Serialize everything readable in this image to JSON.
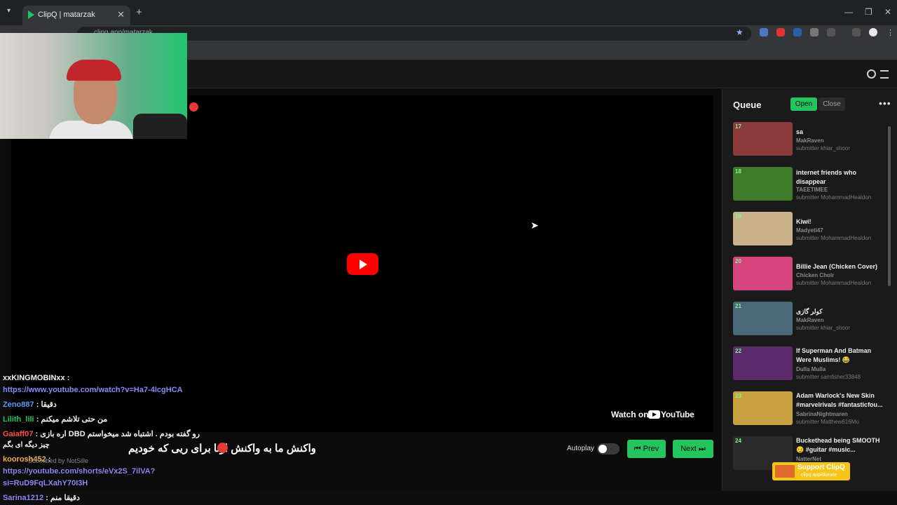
{
  "browser": {
    "tab_title": "ClipQ | matarzak",
    "tab_close": "✕",
    "new_tab": "+",
    "url": "clipq.app/matarzak",
    "window_controls": [
      "—",
      "❐",
      "✕"
    ]
  },
  "player": {
    "watch_on": "Watch on",
    "youtube": "YouTube",
    "autoplay_label": "Autoplay",
    "prev_label": "⏮ Prev",
    "next_label": "Next ⏭"
  },
  "queue": {
    "title": "Queue",
    "open_label": "Open",
    "close_label": "Close",
    "more": "•••",
    "items": [
      {
        "num": "17",
        "title": "sa",
        "channel": "MakRaven",
        "submitter": "submitter khiar_shoor",
        "thumb": "#8a3a3a"
      },
      {
        "num": "18",
        "title": "internet friends who disappear",
        "channel": "TAEETIMEE",
        "submitter": "submitter MohammadHealdon",
        "thumb": "#3f7a2a"
      },
      {
        "num": "19",
        "title": "Kiwi!",
        "channel": "Madyeti47",
        "submitter": "submitter MohammadHealdon",
        "thumb": "#c9b28a"
      },
      {
        "num": "20",
        "title": "Billie Jean (Chicken Cover)",
        "channel": "Chicken Choir",
        "submitter": "submitter MohammadHealdon",
        "thumb": "#d6457e"
      },
      {
        "num": "21",
        "title": "کولر گازی",
        "channel": "MakRaven",
        "submitter": "submitter khiar_shoor",
        "thumb": "#4a6a7a"
      },
      {
        "num": "22",
        "title": "If Superman And Batman Were Muslims! 😂",
        "channel": "Dulla Mulla",
        "submitter": "submitter samfisher33848",
        "thumb": "#5a2a6a"
      },
      {
        "num": "23",
        "title": "Adam Warlock's New Skin #marvelrivals #fantasticfou...",
        "channel": "SabrinaNightmaren",
        "submitter": "submitter Matthew616Mo",
        "thumb": "#c8a040"
      },
      {
        "num": "24",
        "title": "Buckethead being SMOOTH 😏 #guitar #music...",
        "channel": "NatterNet",
        "submitter": "",
        "thumb": "#2a2a2a"
      }
    ]
  },
  "support": {
    "label": "Support ClipQ",
    "url": "clipq.app/donate"
  },
  "chat": {
    "lines": [
      {
        "user": "xxKINGMOBINxx :",
        "text": ""
      },
      {
        "user": "",
        "text": "https://www.youtube.com/watch?v=Ha7-4IcgHCA"
      },
      {
        "user": "Zeno887",
        "text": ": دقیقا"
      },
      {
        "user": "Lilith_lili",
        "text": ": من حتی تلاشم میکنم"
      },
      {
        "user": "Gaiaff07",
        "text": ": اره بازی DBD رو گفته بودم . اشتباه شد میخواستم"
      },
      {
        "user": "",
        "text": "چیز دیگه ای بگم"
      },
      {
        "user": "koorosh452",
        "text": ":"
      },
      {
        "user": "",
        "text": "https://youtube.com/shorts/eVx2S_7ilVA?"
      },
      {
        "user": "",
        "text": "si=RuD9FqLXahY70I3H"
      },
      {
        "user": "Sarina1212",
        "text": ": دقیقا منم"
      }
    ],
    "big_message": "واکنش ما به واکنش اونا برای ریی که خودیم",
    "submitted_by": "Submitted by NotSille"
  },
  "colors": {
    "accent": "#22c55e",
    "user_zeno": "#5b9bf5",
    "user_lilith": "#22c55e",
    "user_gaiaff": "#ff4d4d",
    "user_koorosh": "#f5b041",
    "user_sarina": "#8b8bf5"
  }
}
